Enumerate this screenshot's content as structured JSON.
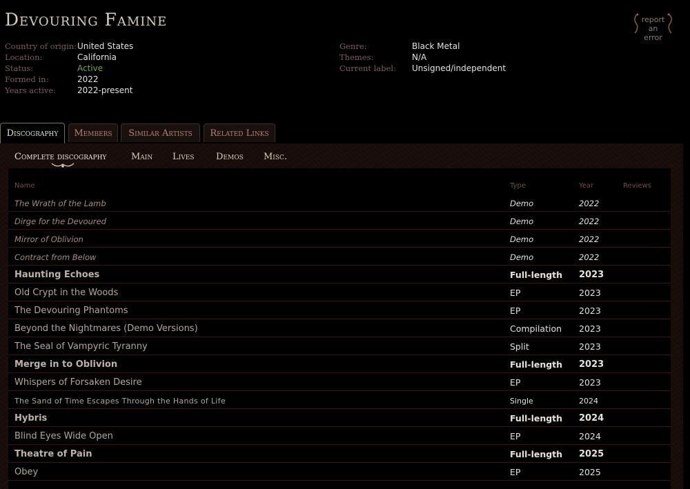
{
  "band": {
    "name": "Devouring Famine"
  },
  "report": {
    "line1": "report",
    "line2": "an error"
  },
  "stats_left": [
    {
      "label": "Country of origin:",
      "value": "United States"
    },
    {
      "label": "Location:",
      "value": "California"
    },
    {
      "label": "Status:",
      "value": "Active",
      "status_color": "#6fa83d"
    },
    {
      "label": "Formed in:",
      "value": "2022"
    },
    {
      "label": "Years active:",
      "value": "2022-present"
    }
  ],
  "stats_right": [
    {
      "label": "Genre:",
      "value": "Black Metal"
    },
    {
      "label": "Themes:",
      "value": "N/A"
    },
    {
      "label": "Current label:",
      "value": "Unsigned/independent"
    }
  ],
  "tabs": [
    {
      "label": "Discography",
      "active": true
    },
    {
      "label": "Members"
    },
    {
      "label": "Similar Artists"
    },
    {
      "label": "Related Links"
    }
  ],
  "subtabs": [
    {
      "label": "Complete discography",
      "selected": true
    },
    {
      "label": "Main"
    },
    {
      "label": "Lives"
    },
    {
      "label": "Demos"
    },
    {
      "label": "Misc."
    }
  ],
  "table": {
    "headers": {
      "name": "Name",
      "type": "Type",
      "year": "Year",
      "reviews": "Reviews"
    },
    "rows": [
      {
        "name": "The Wrath of the Lamb",
        "type": "Demo",
        "year": "2022"
      },
      {
        "name": "Dirge for the Devoured",
        "type": "Demo",
        "year": "2022"
      },
      {
        "name": "Mirror of Oblivion",
        "type": "Demo",
        "year": "2022"
      },
      {
        "name": "Contract from Below",
        "type": "Demo",
        "year": "2022"
      },
      {
        "name": "Haunting Echoes",
        "type": "Full-length",
        "year": "2023"
      },
      {
        "name": "Old Crypt in the Woods",
        "type": "EP",
        "year": "2023"
      },
      {
        "name": "The Devouring Phantoms",
        "type": "EP",
        "year": "2023"
      },
      {
        "name": "Beyond the Nightmares (Demo Versions)",
        "type": "Compilation",
        "year": "2023"
      },
      {
        "name": "The Seal of Vampyric Tyranny",
        "type": "Split",
        "year": "2023"
      },
      {
        "name": "Merge in to Oblivion",
        "type": "Full-length",
        "year": "2023"
      },
      {
        "name": "Whispers of Forsaken Desire",
        "type": "EP",
        "year": "2023"
      },
      {
        "name": "The Sand of Time Escapes Through the Hands of Life",
        "type": "Single",
        "year": "2024"
      },
      {
        "name": "Hybris",
        "type": "Full-length",
        "year": "2024"
      },
      {
        "name": "Blind Eyes Wide Open",
        "type": "EP",
        "year": "2024"
      },
      {
        "name": "Theatre of Pain",
        "type": "Full-length",
        "year": "2025"
      },
      {
        "name": "Obey",
        "type": "EP",
        "year": "2025"
      }
    ]
  }
}
